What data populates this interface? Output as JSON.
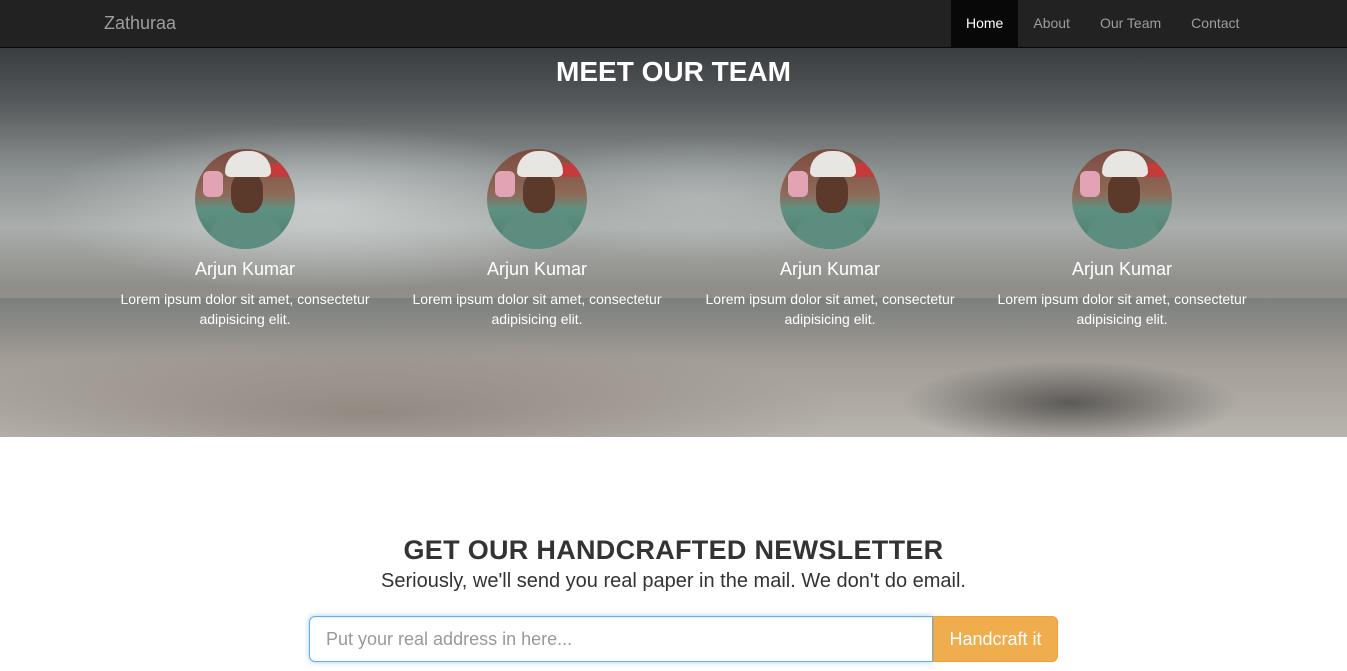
{
  "navbar": {
    "brand": "Zathuraa",
    "items": [
      {
        "label": "Home",
        "active": true
      },
      {
        "label": "About",
        "active": false
      },
      {
        "label": "Our Team",
        "active": false
      },
      {
        "label": "Contact",
        "active": false
      }
    ]
  },
  "team": {
    "title": "MEET OUR TEAM",
    "members": [
      {
        "name": "Arjun Kumar",
        "description": "Lorem ipsum dolor sit amet, consectetur adipisicing elit."
      },
      {
        "name": "Arjun Kumar",
        "description": "Lorem ipsum dolor sit amet, consectetur adipisicing elit."
      },
      {
        "name": "Arjun Kumar",
        "description": "Lorem ipsum dolor sit amet, consectetur adipisicing elit."
      },
      {
        "name": "Arjun Kumar",
        "description": "Lorem ipsum dolor sit amet, consectetur adipisicing elit."
      }
    ]
  },
  "newsletter": {
    "title": "GET OUR HANDCRAFTED NEWSLETTER",
    "subtitle": "Seriously, we'll send you real paper in the mail. We don't do email.",
    "input_placeholder": "Put your real address in here...",
    "input_value": "",
    "button_label": "Handcraft it"
  },
  "colors": {
    "navbar_bg": "#222222",
    "active_nav_bg": "#080808",
    "button_accent": "#f0ad4e",
    "input_focus": "#66afe9"
  }
}
